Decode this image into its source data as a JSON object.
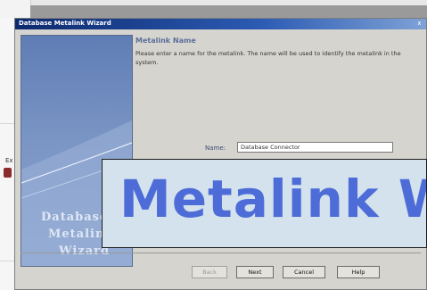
{
  "dialog": {
    "title": "Database Metalink Wizard",
    "close_glyph": "x",
    "heading": "Metalink Name",
    "instructions": "Please enter a name for the metalink. The name will be used to identify the metalink in the system.",
    "name_label": "Name:",
    "name_value": "Database Connector",
    "side_words": [
      "Database",
      "Metalink",
      "Wizard"
    ]
  },
  "buttons": {
    "back": "Back",
    "next": "Next",
    "cancel": "Cancel",
    "help": "Help"
  },
  "background": {
    "left_glyph": "Ex"
  },
  "caption": {
    "text": "Metalink Wizard"
  },
  "colors": {
    "titlebar": "#0c2a6e",
    "caption_text": "#4d6cd8",
    "caption_bg": "#d3e2ec",
    "side_panel": "#7a95c4"
  },
  "icons": {
    "close": "close-icon",
    "background_app": "app-icon"
  }
}
